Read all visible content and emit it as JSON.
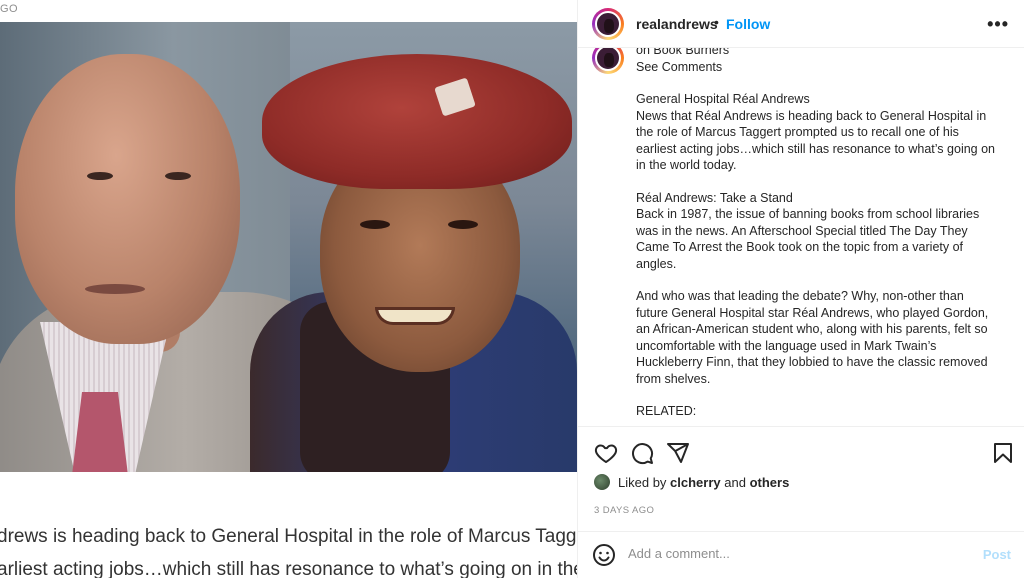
{
  "media": {
    "top_text": "GO",
    "caption_lines": [
      "drews is heading back to General Hospital in the role of Marcus Taggert",
      "arliest acting jobs…which still has resonance to what’s going on in the w"
    ]
  },
  "header": {
    "username": "realandrews",
    "separator": "•",
    "follow_label": "Follow",
    "more_label": "•••"
  },
  "caption": {
    "lines": [
      "on Book Burners",
      "See Comments",
      "",
      "General Hospital Réal Andrews",
      "News that Réal Andrews is heading back to General Hospital in",
      "the role of Marcus Taggert prompted us to recall one of his",
      "earliest acting jobs…which still has resonance to what’s going on",
      "in the world today.",
      "",
      "Réal Andrews: Take a Stand",
      "Back in 1987, the issue of banning books from school libraries",
      "was in the news. An Afterschool Special titled The Day They",
      "Came To Arrest the Book took on the topic from a variety of",
      "angles.",
      "",
      "And who was that leading the debate? Why, non-other than",
      "future General Hospital star Réal Andrews, who played Gordon,",
      "an African-American student who, along with his parents, felt so",
      "uncomfortable with the language used in Mark Twain’s",
      "Huckleberry Finn, that they lobbied to have the classic removed",
      "from shelves.",
      "",
      "RELATED:"
    ]
  },
  "actions": {
    "icons": [
      "heart-icon",
      "comment-icon",
      "share-icon",
      "bookmark-icon"
    ]
  },
  "likes": {
    "prefix": "Liked by",
    "user": "clcherry",
    "and": "and",
    "others": "others"
  },
  "timestamp": "3 DAYS AGO",
  "comment": {
    "placeholder": "Add a comment...",
    "post_label": "Post"
  },
  "colors": {
    "follow": "#0095f6",
    "post_disabled": "#b2dffc",
    "muted": "#8e8e8e"
  }
}
